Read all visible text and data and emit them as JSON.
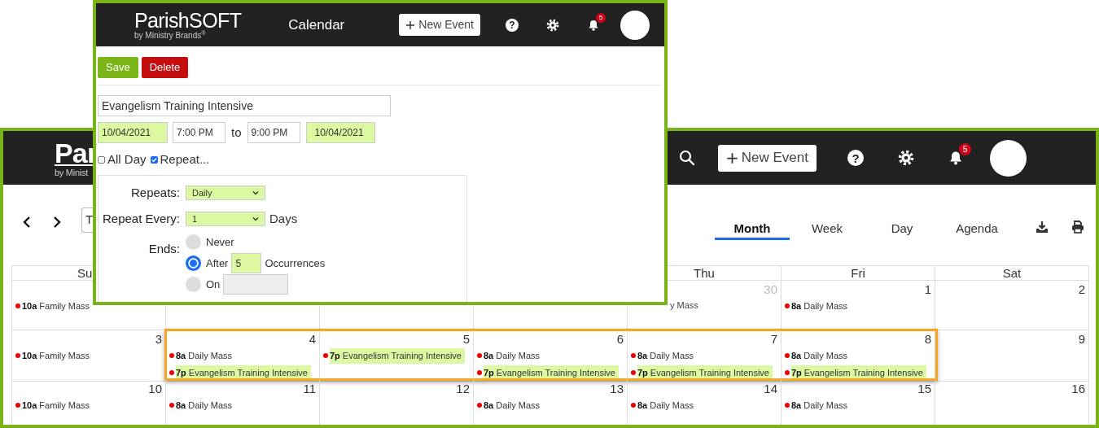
{
  "calendar_window": {
    "logo": {
      "name": "Par",
      "tagline": "by Minist"
    },
    "header": {
      "new_event": "New Event",
      "help": "?",
      "notifications": "5"
    },
    "toolbar": {
      "today_partial": "T"
    },
    "tabs": [
      {
        "label": "Month",
        "selected": true
      },
      {
        "label": "Week",
        "selected": false
      },
      {
        "label": "Day",
        "selected": false
      },
      {
        "label": "Agenda",
        "selected": false
      }
    ],
    "weekdays": {
      "sunday": "Su",
      "thursday": "Thu",
      "friday": "Fri",
      "saturday": "Sat"
    },
    "weeks": [
      {
        "cells": [
          {
            "events": [
              {
                "kind": "event",
                "time": "10a",
                "title": "Family Mass",
                "highlighted": false
              }
            ]
          },
          {},
          {},
          {},
          {
            "day": "30",
            "other_month": true,
            "events": [
              {
                "kind": "fragment",
                "title": "y Mass"
              }
            ]
          },
          {
            "day": "1",
            "other_month": false,
            "events": [
              {
                "kind": "event",
                "time": "8a",
                "title": "Daily Mass",
                "highlighted": false
              }
            ]
          },
          {
            "day": "2",
            "other_month": false
          }
        ]
      },
      {
        "cells": [
          {
            "day": "3",
            "other_month": false,
            "framed": false,
            "events": [
              {
                "kind": "event",
                "time": "10a",
                "title": "Family Mass",
                "highlighted": false
              }
            ]
          },
          {
            "day": "4",
            "other_month": false,
            "framed": true,
            "events": [
              {
                "kind": "event",
                "time": "8a",
                "title": "Daily Mass",
                "highlighted": false
              },
              {
                "kind": "event",
                "time": "7p",
                "title": "Evangelism Training Intensive",
                "highlighted": true
              }
            ]
          },
          {
            "day": "5",
            "other_month": false,
            "framed": true,
            "events": [
              {
                "kind": "event",
                "time": "7p",
                "title": "Evangelism Training Intensive",
                "highlighted": true
              }
            ]
          },
          {
            "day": "6",
            "other_month": false,
            "framed": true,
            "events": [
              {
                "kind": "event",
                "time": "8a",
                "title": "Daily Mass",
                "highlighted": false
              },
              {
                "kind": "event",
                "time": "7p",
                "title": "Evangelism Training Intensive",
                "highlighted": true
              }
            ]
          },
          {
            "day": "7",
            "other_month": false,
            "framed": true,
            "events": [
              {
                "kind": "event",
                "time": "8a",
                "title": "Daily Mass",
                "highlighted": false
              },
              {
                "kind": "event",
                "time": "7p",
                "title": "Evangelism Training Intensive",
                "highlighted": true
              }
            ]
          },
          {
            "day": "8",
            "other_month": false,
            "framed": true,
            "events": [
              {
                "kind": "event",
                "time": "8a",
                "title": "Daily Mass",
                "highlighted": false
              },
              {
                "kind": "event",
                "time": "7p",
                "title": "Evangelism Training Intensive",
                "highlighted": true
              }
            ]
          },
          {
            "day": "9",
            "other_month": false,
            "framed": false
          }
        ]
      },
      {
        "cells": [
          {
            "day": "10",
            "other_month": false,
            "events": [
              {
                "kind": "event",
                "time": "10a",
                "title": "Family Mass",
                "highlighted": false
              }
            ]
          },
          {
            "day": "11",
            "other_month": false,
            "events": [
              {
                "kind": "event",
                "time": "8a",
                "title": "Daily Mass",
                "highlighted": false
              }
            ]
          },
          {
            "day": "12",
            "other_month": false
          },
          {
            "day": "13",
            "other_month": false,
            "events": [
              {
                "kind": "event",
                "time": "8a",
                "title": "Daily Mass",
                "highlighted": false
              }
            ]
          },
          {
            "day": "14",
            "other_month": false,
            "events": [
              {
                "kind": "event",
                "time": "8a",
                "title": "Daily Mass",
                "highlighted": false
              }
            ]
          },
          {
            "day": "15",
            "other_month": false,
            "events": [
              {
                "kind": "event",
                "time": "8a",
                "title": "Daily Mass",
                "highlighted": false
              }
            ]
          },
          {
            "day": "16",
            "other_month": false
          }
        ]
      }
    ]
  },
  "event_window": {
    "logo": {
      "name": "ParishSOFT",
      "tagline": "by Ministry Brands$^{®}$"
    },
    "header": {
      "title": "Calendar",
      "new_event": "New Event",
      "help": "?",
      "notifications": "5"
    },
    "buttons": {
      "save": "Save",
      "delete": "Delete"
    },
    "event_title": "Evangelism Training Intensive",
    "start_date": "10/04/2021",
    "start_time": "7:00 PM",
    "to": "to",
    "end_time": "9:00 PM",
    "end_date": "10/04/2021",
    "options": [
      {
        "label": "All Day",
        "checked": false
      },
      {
        "label": "Repeat...",
        "checked": true
      }
    ],
    "repeat": {
      "repeats_label": "Repeats:",
      "repeats_value": "Daily",
      "every_label": "Repeat Every:",
      "every_value": "1",
      "every_unit": "Days",
      "ends_label": "Ends:",
      "ends": [
        {
          "kind": "never",
          "label": "Never",
          "selected": false
        },
        {
          "kind": "after",
          "label": "After",
          "value": "5",
          "unit": "Occurrences",
          "selected": true
        },
        {
          "kind": "on",
          "label": "On",
          "selected": false
        }
      ]
    }
  }
}
